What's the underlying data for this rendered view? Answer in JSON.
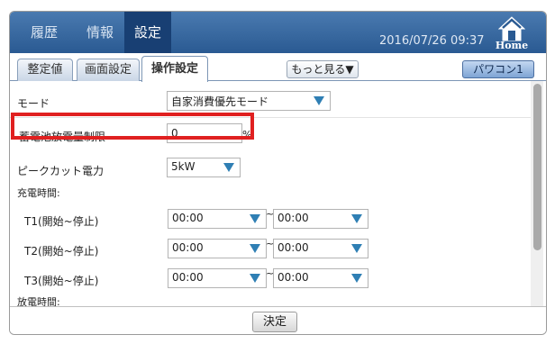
{
  "header": {
    "tabs": [
      {
        "label": "履歴"
      },
      {
        "label": "情報"
      },
      {
        "label": "設定"
      }
    ],
    "datetime": "2016/07/26 09:37",
    "home_label": "Home"
  },
  "subtabs": [
    {
      "label": "整定値"
    },
    {
      "label": "画面設定"
    },
    {
      "label": "操作設定"
    }
  ],
  "more_button": "もっと見る▼",
  "pc_button": "パワコン1",
  "rows": {
    "mode": {
      "label": "モード",
      "value": "自家消費優先モード"
    },
    "charge_limit": {
      "label": "蓄電池放電量制限",
      "value": "0",
      "unit": "%"
    },
    "peak_cut": {
      "label": "ピークカット電力",
      "value": "5kW"
    },
    "charge_time_header": "充電時間:",
    "t1": {
      "label": "T1(開始~停止)",
      "start": "00:00",
      "end": "00:00"
    },
    "t2": {
      "label": "T2(開始~停止)",
      "start": "00:00",
      "end": "00:00"
    },
    "t3": {
      "label": "T3(開始~停止)",
      "start": "00:00",
      "end": "00:00"
    },
    "discharge_time_header": "放電時間:",
    "tilde": "~"
  },
  "ok_button": "決定",
  "colors": {
    "header": "#2a5a92",
    "active_tab": "#183f73",
    "highlight": "#e02020",
    "arrow": "#2f7fb4"
  }
}
